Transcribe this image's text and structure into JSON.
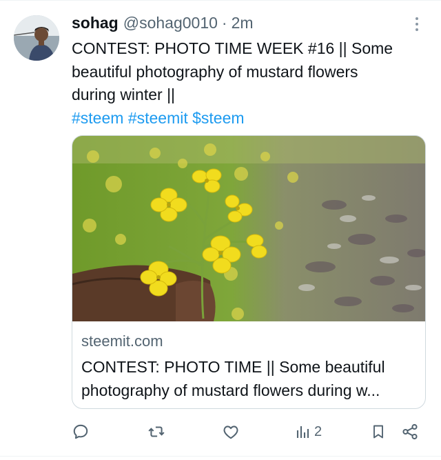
{
  "author": {
    "name": "sohag",
    "handle": "@sohag0010",
    "separator": "·",
    "time": "2m"
  },
  "post": {
    "text_line1": "CONTEST: PHOTO TIME WEEK #16 || Some",
    "text_line2": "beautiful photography of mustard flowers",
    "text_line3": "during winter ||",
    "hashtags": "#steem #steemit $steem"
  },
  "card": {
    "domain": "steemit.com",
    "title_line1": "CONTEST: PHOTO TIME || Some beautiful",
    "title_line2": "photography of mustard flowers during w..."
  },
  "actions": {
    "views_count": "2"
  },
  "icons": [
    "more-icon",
    "reply-icon",
    "retweet-icon",
    "like-icon",
    "views-icon",
    "bookmark-icon",
    "share-icon"
  ],
  "colors": {
    "link": "#1d9bf0",
    "text": "#0f1419",
    "muted": "#536471",
    "border": "#cfd9de"
  }
}
